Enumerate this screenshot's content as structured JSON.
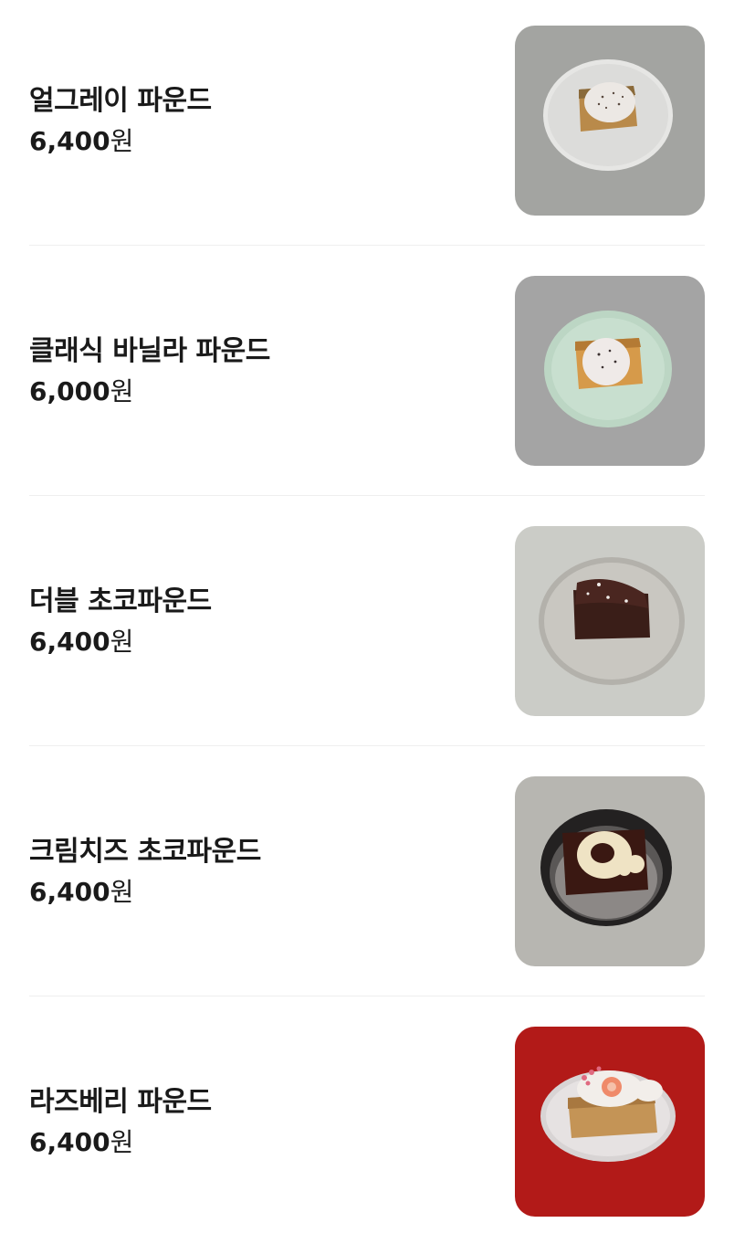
{
  "menu": {
    "items": [
      {
        "name": "얼그레이 파운드",
        "price": "6,400",
        "currency": "원",
        "image": "earl-grey-pound-cake-photo"
      },
      {
        "name": "클래식 바닐라 파운드",
        "price": "6,000",
        "currency": "원",
        "image": "classic-vanilla-pound-cake-photo"
      },
      {
        "name": "더블 초코파운드",
        "price": "6,400",
        "currency": "원",
        "image": "double-chocolate-pound-cake-photo"
      },
      {
        "name": "크림치즈 초코파운드",
        "price": "6,400",
        "currency": "원",
        "image": "cream-cheese-chocolate-pound-cake-photo"
      },
      {
        "name": "라즈베리 파운드",
        "price": "6,400",
        "currency": "원",
        "image": "raspberry-pound-cake-photo"
      }
    ]
  },
  "colors": {
    "text": "#1a1a1a",
    "divider": "#efefef",
    "background": "#ffffff"
  }
}
